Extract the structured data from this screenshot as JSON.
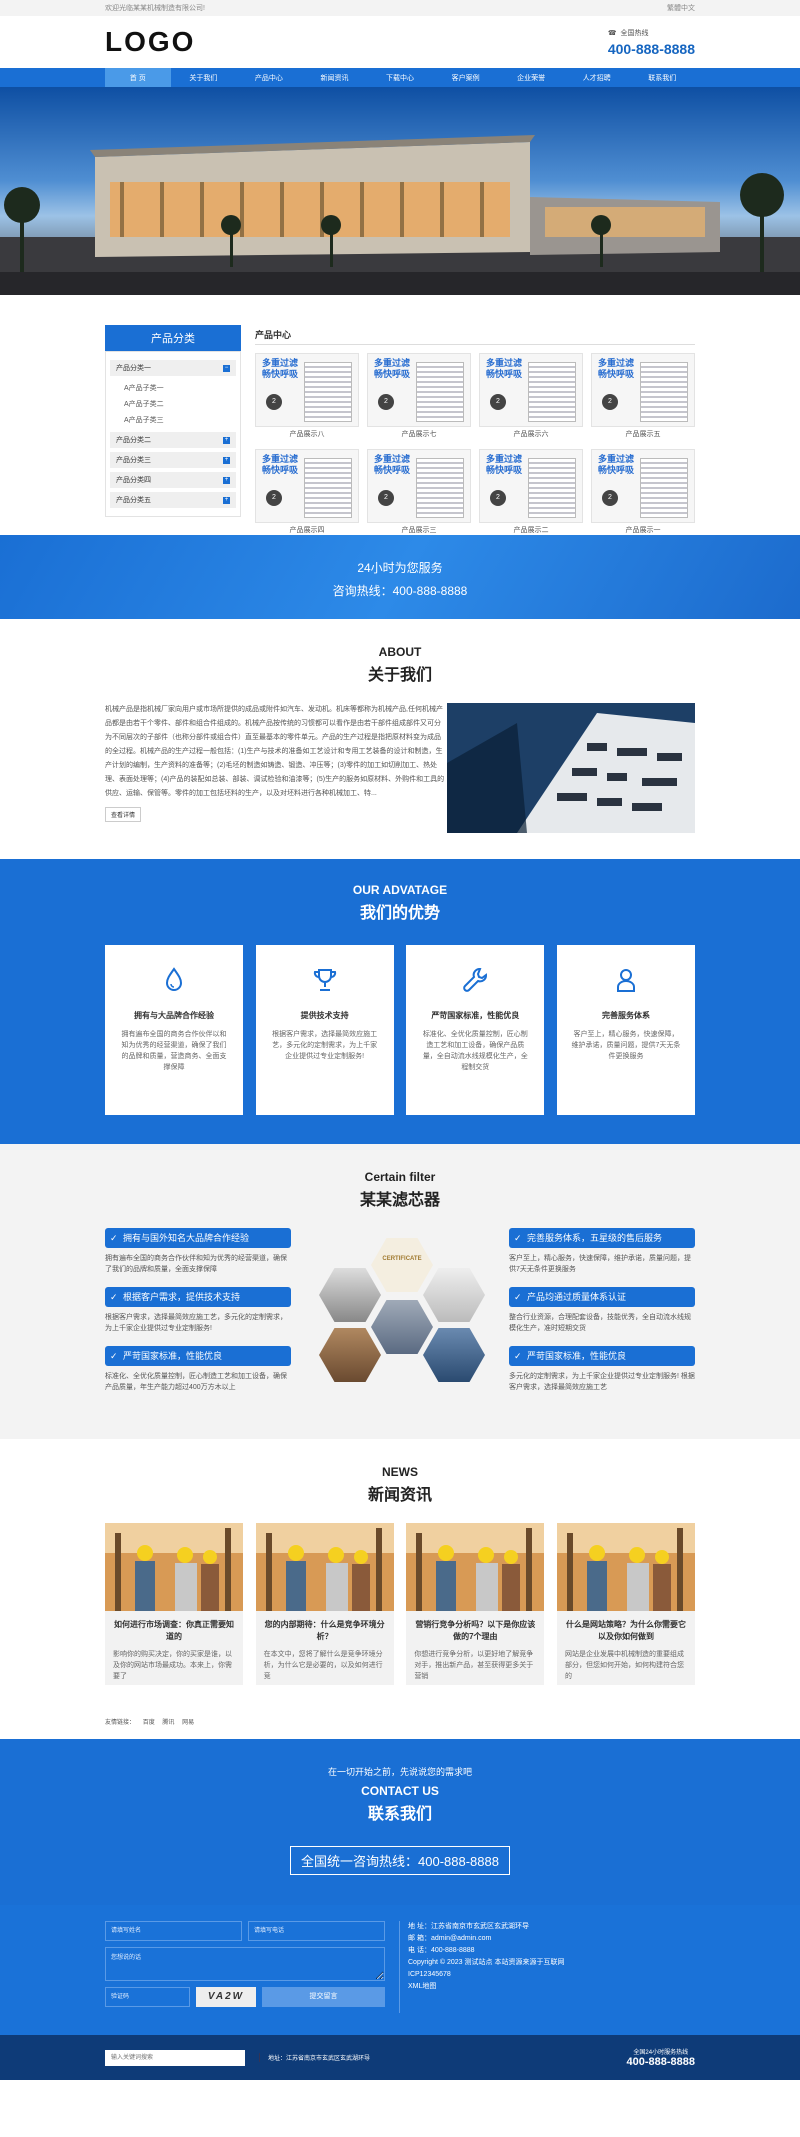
{
  "topbar": {
    "welcome": "欢迎光临某某机械制造有限公司!",
    "right": "繁體中文"
  },
  "header": {
    "logo": "LOGO",
    "hotline_label": "全国热线",
    "hotline_number": "400-888-8888"
  },
  "nav": [
    "首 页",
    "关于我们",
    "产品中心",
    "新闻资讯",
    "下载中心",
    "客户案例",
    "企业荣誉",
    "人才招聘",
    "联系我们"
  ],
  "products": {
    "sidebar_title": "产品分类",
    "categories": [
      {
        "label": "产品分类一",
        "subs": [
          "A产品子类一",
          "A产品子类二",
          "A产品子类三"
        ]
      },
      {
        "label": "产品分类二",
        "subs": []
      },
      {
        "label": "产品分类三",
        "subs": []
      },
      {
        "label": "产品分类四",
        "subs": []
      },
      {
        "label": "产品分类五",
        "subs": []
      }
    ],
    "main_title": "产品中心",
    "promo_line1": "多重过滤",
    "promo_line2": "畅快呼吸",
    "badge": "2",
    "items": [
      "产品展示八",
      "产品展示七",
      "产品展示六",
      "产品展示五",
      "产品展示四",
      "产品展示三",
      "产品展示二",
      "产品展示一"
    ]
  },
  "service": {
    "line1": "24小时为您服务",
    "line2": "咨询热线：400-888-8888"
  },
  "about": {
    "en": "ABOUT",
    "zh": "关于我们",
    "text": "机械产品是指机械厂家向用户或市场所提供的成品或附件如汽车、发动机。机床等都称为机械产品,任何机械产品都是由若干个零件、部件和组合件组成的。机械产品按传统的习惯都可以看作是由若干部件组成部件又可分为不同层次的子部件（也称分部件或组合件）直至最基本的零件单元。产品的生产过程是指把原材料变为成品的全过程。机械产品的生产过程一般包括：(1)生产与技术的准备如工艺设计和专用工艺装备的设计和制造，生产计划的编制，生产资料的准备等；(2)毛坯的制造如铸造、锻造、冲压等；(3)零件的加工如切削加工、热处理、表面处理等；(4)产品的装配如总装、部装、调试检验和油漆等；(5)生产的服务如原材料、外购件和工具的供应、运输、保管等。零件的加工包括坯料的生产，以及对坯料进行各种机械加工、特...",
    "more": "查看详情"
  },
  "advantages": {
    "en": "OUR ADVATAGE",
    "zh": "我们的优势",
    "cards": [
      {
        "icon": "water-drop-icon",
        "title": "拥有与大品牌合作经验",
        "desc": "拥有遍布全国的商务合作伙伴以和知为优秀的经营渠道，确保了我们的品牌和质量，营造商务、全面支撑保障"
      },
      {
        "icon": "trophy-icon",
        "title": "提供技术支持",
        "desc": "根据客户需求，选择最简效应施工艺，多元化的定制需求，为上千家企业提供过专业定制服务!"
      },
      {
        "icon": "wrench-icon",
        "title": "严苛国家标准，性能优良",
        "desc": "标准化、全优化质量控制，匠心制造工艺和加工设备，确保产品质量，全自动流水线规模化生产，全程制交货"
      },
      {
        "icon": "user-icon",
        "title": "完善服务体系",
        "desc": "客户至上，精心服务，快速保障，维护承诺，质量问题，提供7天无条件更换服务"
      }
    ]
  },
  "filter": {
    "en": "Certain filter",
    "zh": "某某滤芯器",
    "left": [
      {
        "title": "拥有与国外知名大品牌合作经验",
        "desc": "拥有遍布全国的商务合作伙伴和知为优秀的经营渠道，确保了我们的品牌和质量，全面支撑保障"
      },
      {
        "title": "根据客户需求，提供技术支持",
        "desc": "根据客户需求，选择最简效应施工艺，多元化的定制需求，为上千家企业提供过专业定制服务!"
      },
      {
        "title": "严苛国家标准，性能优良",
        "desc": "标准化、全优化质量控制，匠心制造工艺和加工设备，确保产品质量，年生产能力超过400万方木以上"
      }
    ],
    "right": [
      {
        "title": "完善服务体系，五星级的售后服务",
        "desc": "客户至上，精心服务，快速保障，维护承诺，质量问题，提供7天无条件更换服务"
      },
      {
        "title": "产品均通过质量体系认证",
        "desc": "整合行业资源，合理配套设备，技能优秀，全自动流水线规模化生产，准时短期交货"
      },
      {
        "title": "严苛国家标准，性能优良",
        "desc": "多元化的定制需求，为上千家企业提供过专业定制服务! 根据客户需求，选择最简效应施工艺"
      }
    ],
    "certificate": "CERTIFICATE"
  },
  "news": {
    "en": "NEWS",
    "zh": "新闻资讯",
    "items": [
      {
        "title": "如何进行市场调查：你真正需要知道的",
        "desc": "影响你的购买决定，你的买家是谁，以及你的网站市场最成功。本来上，你需要了"
      },
      {
        "title": "您的内部期待：什么是竞争环境分析？",
        "desc": "在本文中，您将了解什么是竞争环境分析，为什么它是必要的，以及如何进行竞"
      },
      {
        "title": "营销行竞争分析吗？以下是你应该做的7个理由",
        "desc": "你想进行竞争分析，以更好地了解竞争对手，推出新产品，甚至获得更多关于营销"
      },
      {
        "title": "什么是网站策略？为什么你需要它以及你如何做到",
        "desc": "网站是企业发展中机械制造的重要组成部分，但您如何开始，如何构建符合您的"
      }
    ]
  },
  "links": {
    "label": "友情链接：",
    "items": [
      "百度",
      "腾讯",
      "网易"
    ]
  },
  "contact": {
    "line": "在一切开始之前，先说说您的需求吧",
    "en": "CONTACT US",
    "zh": "联系我们",
    "hotline": "全国统一咨询热线：400-888-8888"
  },
  "form": {
    "name_ph": "请填写姓名",
    "phone_ph": "请填写电话",
    "msg_ph": "您想说的话",
    "captcha_ph": "验证码",
    "captcha_img": "VA2W",
    "submit": "提交留言"
  },
  "info": {
    "address": "地 址：江苏省南京市玄武区玄武湖环导",
    "email": "邮 箱：admin@admin.com",
    "phone": "电 话：400-888-8888",
    "copyright": "Copyright © 2023 测试站点 本站资源来源于互联网",
    "icp": "ICP12345678",
    "sitemap": "XML地图"
  },
  "bottom": {
    "search_ph": "输入关键词搜索",
    "address": "地址：江苏省南京市玄武区玄武湖环导",
    "hot_label": "全国24小时服务热线",
    "hot_number": "400-888-8888"
  }
}
